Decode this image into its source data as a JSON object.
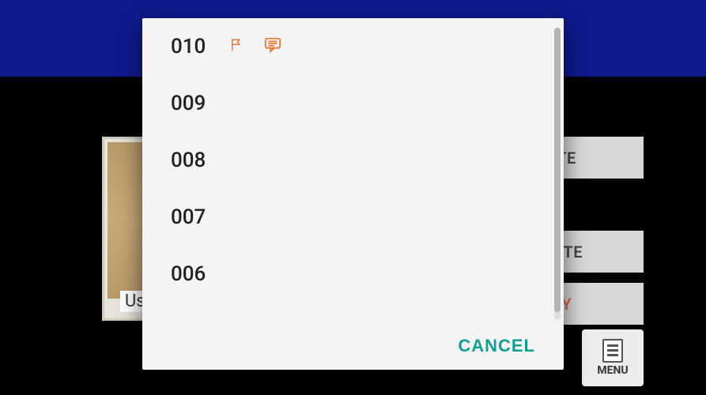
{
  "background": {
    "card_label": "Usi",
    "buttons": {
      "delete": "ETE",
      "note": "NOTE",
      "play": "AY"
    },
    "menu_label": "MENU"
  },
  "dialog": {
    "items": [
      {
        "label": "010",
        "has_flag": true,
        "has_note": true
      },
      {
        "label": "009",
        "has_flag": false,
        "has_note": false
      },
      {
        "label": "008",
        "has_flag": false,
        "has_note": false
      },
      {
        "label": "007",
        "has_flag": false,
        "has_note": false
      },
      {
        "label": "006",
        "has_flag": false,
        "has_note": false
      }
    ],
    "cancel_label": "CANCEL"
  },
  "colors": {
    "accent_teal": "#139e8f",
    "accent_orange": "#e06a4a",
    "topbar": "#0f1a8f"
  }
}
